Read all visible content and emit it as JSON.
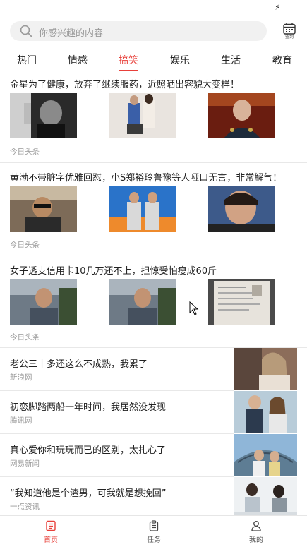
{
  "search": {
    "placeholder": "你感兴趣的内容",
    "calendar_label": "签到"
  },
  "tabs": [
    {
      "label": "热门"
    },
    {
      "label": "情感"
    },
    {
      "label": "搞笑"
    },
    {
      "label": "娱乐"
    },
    {
      "label": "生活"
    },
    {
      "label": "教育"
    }
  ],
  "active_tab": "搞笑",
  "articles": [
    {
      "title": "金星为了健康，放弃了继续服药，近照晒出容貌大变样！",
      "source": "今日头条"
    },
    {
      "title": "黄渤不带脏字优雅回怼，小S郑裕玲鲁豫等人哑口无言，非常解气！",
      "source": "今日头条"
    },
    {
      "title": "女子透支信用卡10几万还不上，担惊受怕瘦成60斤",
      "source": "今日头条"
    }
  ],
  "side_articles": [
    {
      "title": "老公三十多还这么不成熟，我累了",
      "source": "新浪网"
    },
    {
      "title": "初恋脚踏两船一年时间，我居然没发现",
      "source": "腾讯网"
    },
    {
      "title": "真心爱你和玩玩而已的区别，太扎心了",
      "source": "网易新闻"
    },
    {
      "title": "“我知道他是个渣男，可我就是想挽回”",
      "source": "一点资讯"
    }
  ],
  "bottom_nav": [
    {
      "label": "首页"
    },
    {
      "label": "任务"
    },
    {
      "label": "我的"
    }
  ],
  "colors": {
    "accent": "#e8403a",
    "muted": "#999999",
    "search_bg": "#f1f1f1"
  }
}
